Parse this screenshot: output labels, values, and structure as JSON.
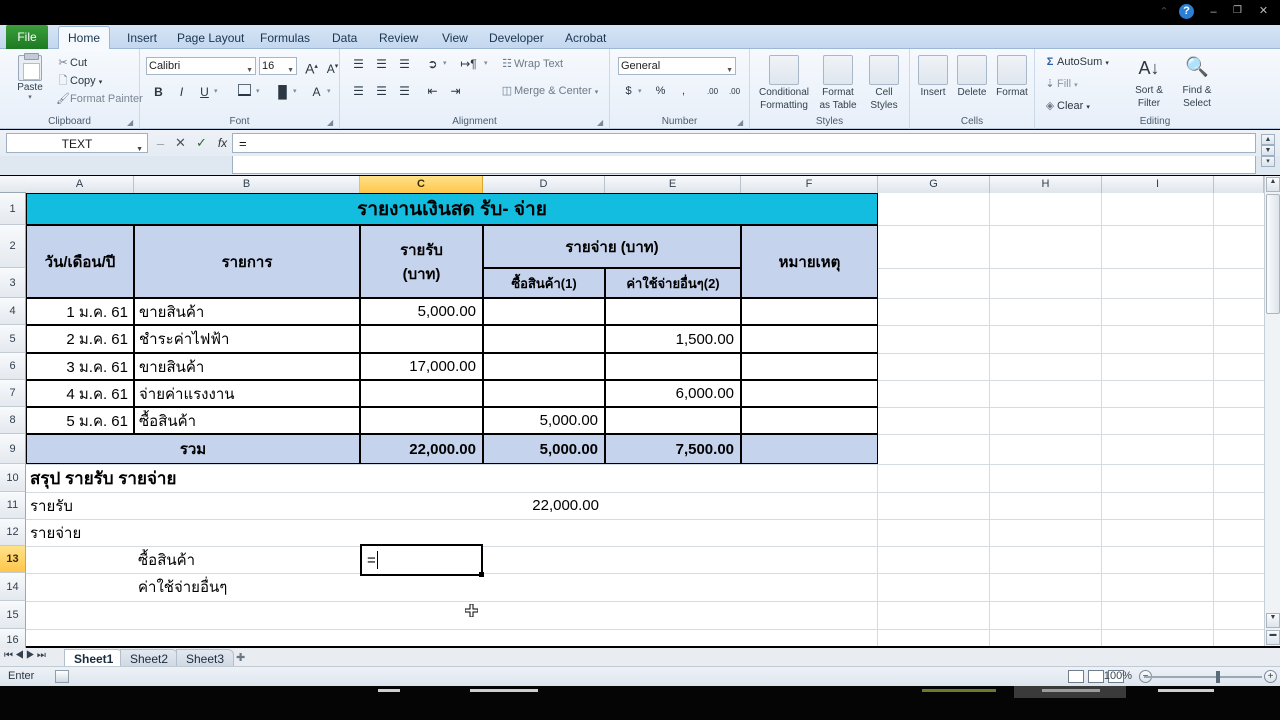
{
  "window": {
    "controls": [
      "minimize-ribbon",
      "help",
      "minimize",
      "restore",
      "close"
    ],
    "help_glyph": "?",
    "chevron_glyph": "⌃",
    "minimize_glyph": "–",
    "restore_glyph": "❐",
    "close_glyph": "✕"
  },
  "ribbon": {
    "file_tab": "File",
    "tabs": [
      "Home",
      "Insert",
      "Page Layout",
      "Formulas",
      "Data",
      "Review",
      "View",
      "Developer",
      "Acrobat"
    ],
    "active_tab": "Home",
    "groups": [
      {
        "name": "Clipboard",
        "label": "Clipboard"
      },
      {
        "name": "Font",
        "label": "Font"
      },
      {
        "name": "Alignment",
        "label": "Alignment"
      },
      {
        "name": "Number",
        "label": "Number"
      },
      {
        "name": "Styles",
        "label": "Styles"
      },
      {
        "name": "Cells",
        "label": "Cells"
      },
      {
        "name": "Editing",
        "label": "Editing"
      }
    ],
    "clipboard": {
      "paste": "Paste",
      "cut": "Cut",
      "copy": "Copy",
      "format_painter": "Format Painter"
    },
    "font": {
      "family": "Calibri",
      "size": "16",
      "grow": "A",
      "shrink": "A",
      "bold": "B",
      "italic": "I",
      "underline": "U"
    },
    "alignment": {
      "wrap_text": "Wrap Text",
      "merge_center": "Merge & Center"
    },
    "number": {
      "format": "General",
      "currency": "$",
      "percent": "%",
      "comma": ",",
      "increase_decimal": ".00",
      "decrease_decimal": ".00"
    },
    "styles": {
      "conditional_formatting": "Conditional\nFormatting",
      "conditional_line1": "Conditional",
      "conditional_line2": "Formatting",
      "format_as_table_line1": "Format",
      "format_as_table_line2": "as Table",
      "cell_styles_line1": "Cell",
      "cell_styles_line2": "Styles"
    },
    "cells": {
      "insert": "Insert",
      "delete": "Delete",
      "format": "Format"
    },
    "editing": {
      "autosum": "AutoSum",
      "fill": "Fill",
      "clear": "Clear",
      "sort_filter_line1": "Sort &",
      "sort_filter_line2": "Filter",
      "find_select_line1": "Find &",
      "find_select_line2": "Select",
      "sigma": "Σ"
    }
  },
  "formula_bar": {
    "name_box": "TEXT",
    "cancel": "✕",
    "enter": "✓",
    "function": "fx",
    "value": "="
  },
  "grid": {
    "columns": [
      "A",
      "B",
      "C",
      "D",
      "E",
      "F",
      "G",
      "H",
      "I"
    ],
    "selected_column": "C",
    "rows": [
      "1",
      "2",
      "3",
      "4",
      "5",
      "6",
      "7",
      "8",
      "9",
      "10",
      "11",
      "12",
      "13",
      "14",
      "15",
      "16"
    ],
    "selected_row": "13",
    "banner_title": "รายงานเงินสด รับ- จ่าย",
    "headers": {
      "date": "วัน/เดือน/ปี",
      "item": "รายการ",
      "income_line1": "รายรับ",
      "income_line2": "(บาท)",
      "expense": "รายจ่าย (บาท)",
      "purchase": "ซื้อสินค้า(1)",
      "other_expense": "ค่าใช้จ่ายอื่นๆ(2)",
      "remark": "หมายเหตุ"
    },
    "entries": [
      {
        "row": "4",
        "date": "1 ม.ค. 61",
        "item": "ขายสินค้า",
        "income": "5,000.00",
        "purchase": "",
        "other": "",
        "remark": ""
      },
      {
        "row": "5",
        "date": "2 ม.ค. 61",
        "item": "ชำระค่าไฟฟ้า",
        "income": "",
        "purchase": "",
        "other": "1,500.00",
        "remark": ""
      },
      {
        "row": "6",
        "date": "3 ม.ค. 61",
        "item": "ขายสินค้า",
        "income": "17,000.00",
        "purchase": "",
        "other": "",
        "remark": ""
      },
      {
        "row": "7",
        "date": "4 ม.ค. 61",
        "item": "จ่ายค่าแรงงาน",
        "income": "",
        "purchase": "",
        "other": "6,000.00",
        "remark": ""
      },
      {
        "row": "8",
        "date": "5 ม.ค. 61",
        "item": "ซื้อสินค้า",
        "income": "",
        "purchase": "5,000.00",
        "other": "",
        "remark": ""
      }
    ],
    "total_row": {
      "row": "9",
      "label": "รวม",
      "income": "22,000.00",
      "purchase": "5,000.00",
      "other": "7,500.00",
      "remark": ""
    },
    "summary": {
      "title_row": "10",
      "title": "สรุป รายรับ รายจ่าย",
      "income_row": "11",
      "income_label": "รายรับ",
      "income_value": "22,000.00",
      "expense_row": "12",
      "expense_label": "รายจ่าย",
      "purchase_row": "13",
      "purchase_label": "ซื้อสินค้า",
      "other_row": "14",
      "other_label": "ค่าใช้จ่ายอื่นๆ"
    },
    "active_cell": {
      "reference": "C13",
      "editing_value": "="
    }
  },
  "sheet_tabs": {
    "tabs": [
      "Sheet1",
      "Sheet2",
      "Sheet3"
    ],
    "active": "Sheet1",
    "insert_sheet": "insert-sheet-icon",
    "nav_first": "⏮",
    "nav_prev": "◀",
    "nav_next": "▶",
    "nav_last": "⏭"
  },
  "status_bar": {
    "mode": "Enter",
    "zoom": "100%",
    "views": [
      "normal-view",
      "page-layout-view",
      "page-break-view"
    ]
  },
  "colors": {
    "banner": "#12BDE0",
    "header_fill": "#C5D3EC",
    "selection_header": "#FFC64B",
    "file_tab_green": "#1d7a23"
  }
}
